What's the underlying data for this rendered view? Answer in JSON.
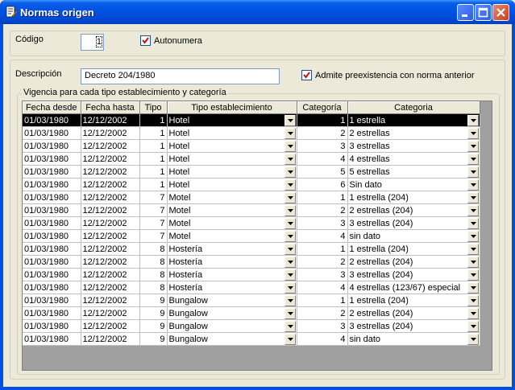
{
  "window": {
    "title": "Normas origen"
  },
  "form": {
    "codigo_label": "Código",
    "codigo_value": "1",
    "autonumera_label": "Autonumera",
    "descripcion_label": "Descripción",
    "descripcion_value": "Decreto 204/1980",
    "admite_label": "Admite preexistencia con norma anterior",
    "vigencia_label": "Vigencia para cada tipo establecimiento y categoría"
  },
  "grid": {
    "headers": [
      "Fecha desde",
      "Fecha hasta",
      "Tipo",
      "Tipo establecimiento",
      "Categoría",
      "Categoria"
    ],
    "rows": [
      [
        "01/03/1980",
        "12/12/2002",
        "1",
        "Hotel",
        "1",
        "1 estrella"
      ],
      [
        "01/03/1980",
        "12/12/2002",
        "1",
        "Hotel",
        "2",
        "2 estrellas"
      ],
      [
        "01/03/1980",
        "12/12/2002",
        "1",
        "Hotel",
        "3",
        "3 estrellas"
      ],
      [
        "01/03/1980",
        "12/12/2002",
        "1",
        "Hotel",
        "4",
        "4 estrellas"
      ],
      [
        "01/03/1980",
        "12/12/2002",
        "1",
        "Hotel",
        "5",
        "5 estrellas"
      ],
      [
        "01/03/1980",
        "12/12/2002",
        "1",
        "Hotel",
        "6",
        "Sin dato"
      ],
      [
        "01/03/1980",
        "12/12/2002",
        "7",
        "Motel",
        "1",
        "1 estrella (204)"
      ],
      [
        "01/03/1980",
        "12/12/2002",
        "7",
        "Motel",
        "2",
        "2 estrellas (204)"
      ],
      [
        "01/03/1980",
        "12/12/2002",
        "7",
        "Motel",
        "3",
        "3 estrellas (204)"
      ],
      [
        "01/03/1980",
        "12/12/2002",
        "7",
        "Motel",
        "4",
        "sin dato"
      ],
      [
        "01/03/1980",
        "12/12/2002",
        "8",
        "Hostería",
        "1",
        "1 estrella (204)"
      ],
      [
        "01/03/1980",
        "12/12/2002",
        "8",
        "Hostería",
        "2",
        "2 estrellas (204)"
      ],
      [
        "01/03/1980",
        "12/12/2002",
        "8",
        "Hostería",
        "3",
        "3 estrellas (204)"
      ],
      [
        "01/03/1980",
        "12/12/2002",
        "8",
        "Hostería",
        "4",
        "4 estrellas (123/67) especial"
      ],
      [
        "01/03/1980",
        "12/12/2002",
        "9",
        "Bungalow",
        "1",
        "1 estrella (204)"
      ],
      [
        "01/03/1980",
        "12/12/2002",
        "9",
        "Bungalow",
        "2",
        "2 estrellas (204)"
      ],
      [
        "01/03/1980",
        "12/12/2002",
        "9",
        "Bungalow",
        "3",
        "3 estrellas (204)"
      ],
      [
        "01/03/1980",
        "12/12/2002",
        "9",
        "Bungalow",
        "4",
        "sin dato"
      ]
    ]
  }
}
